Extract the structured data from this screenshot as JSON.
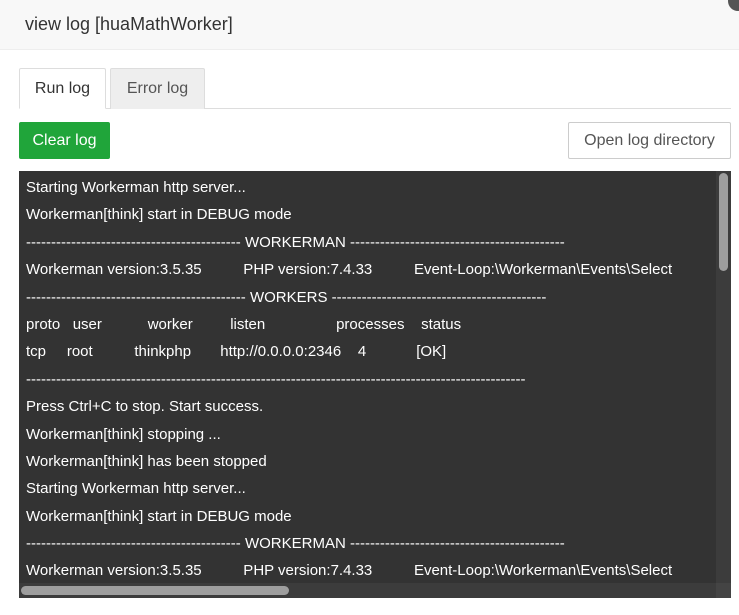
{
  "dialog": {
    "title": "view log [huaMathWorker]"
  },
  "tabs": [
    {
      "label": "Run log",
      "active": true
    },
    {
      "label": "Error log",
      "active": false
    }
  ],
  "toolbar": {
    "clear_label": "Clear log",
    "open_label": "Open log directory"
  },
  "colors": {
    "accent": "#20a53a",
    "log_background": "#333333",
    "log_text": "#ffffff"
  },
  "log": {
    "lines": [
      "Starting Workerman http server...",
      "Workerman[think] start in DEBUG mode",
      "------------------------------------------- WORKERMAN -------------------------------------------",
      "Workerman version:3.5.35          PHP version:7.4.33          Event-Loop:\\Workerman\\Events\\Select",
      "-------------------------------------------- WORKERS -------------------------------------------",
      "proto   user           worker         listen                 processes    status",
      "tcp     root          thinkphp       http://0.0.0.0:2346    4            [OK]",
      "----------------------------------------------------------------------------------------------------",
      "Press Ctrl+C to stop. Start success.",
      "Workerman[think] stopping ...",
      "Workerman[think] has been stopped",
      "Starting Workerman http server...",
      "Workerman[think] start in DEBUG mode",
      "------------------------------------------- WORKERMAN -------------------------------------------",
      "Workerman version:3.5.35          PHP version:7.4.33          Event-Loop:\\Workerman\\Events\\Select"
    ]
  }
}
